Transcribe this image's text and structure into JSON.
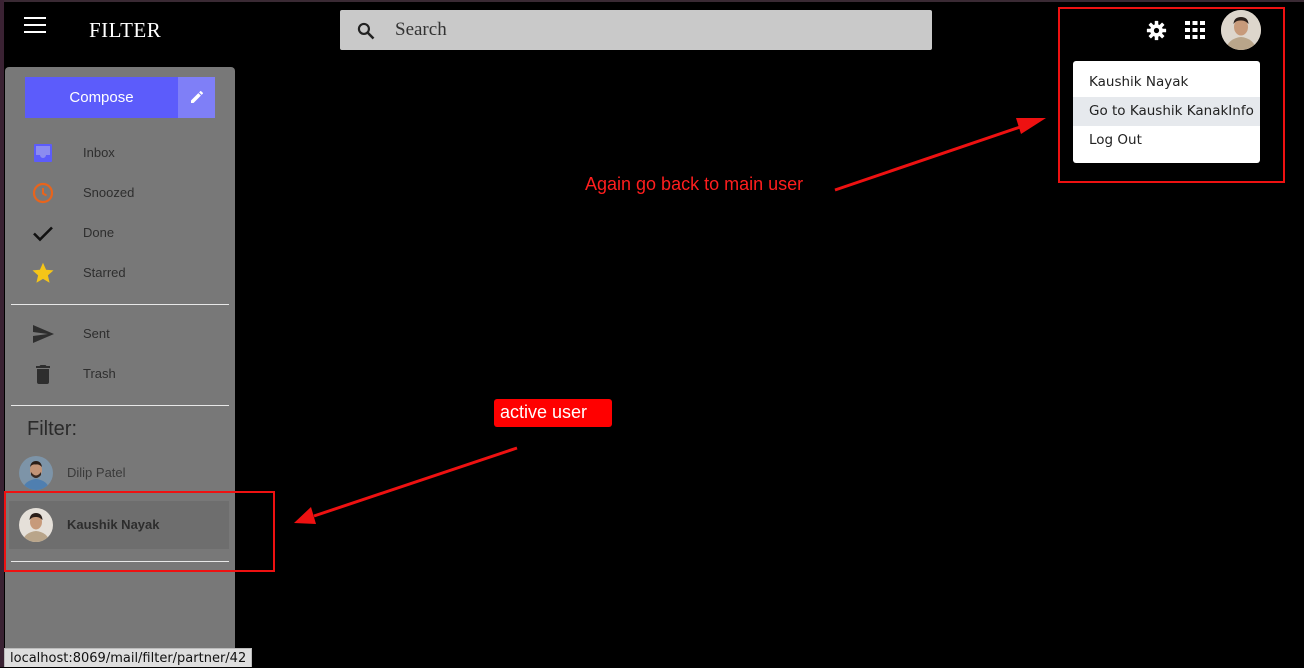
{
  "header": {
    "title": "FILTER",
    "search_placeholder": "Search"
  },
  "user_menu": {
    "items": [
      "Kaushik Nayak",
      "Go to Kaushik KanakInfo",
      "Log Out"
    ]
  },
  "sidebar": {
    "compose_label": "Compose",
    "nav_primary": [
      {
        "label": "Inbox",
        "icon": "inbox-icon",
        "color": "#5c5cfb"
      },
      {
        "label": "Snoozed",
        "icon": "clock-icon",
        "color": "#e8641c"
      },
      {
        "label": "Done",
        "icon": "check-icon",
        "color": "#111111"
      },
      {
        "label": "Starred",
        "icon": "star-icon",
        "color": "#f5c518"
      }
    ],
    "nav_secondary": [
      {
        "label": "Sent",
        "icon": "send-icon",
        "color": "#2e2e2e"
      },
      {
        "label": "Trash",
        "icon": "trash-icon",
        "color": "#2e2e2e"
      }
    ],
    "filter_label": "Filter:",
    "filter_users": [
      {
        "name": "Dilip Patel",
        "active": false
      },
      {
        "name": "Kaushik Nayak",
        "active": true
      }
    ]
  },
  "annotations": {
    "main_user_note": "Again go back to main user",
    "active_user_note": "active user",
    "color": "#ff1e1e"
  },
  "status_bar": {
    "url": "localhost:8069/mail/filter/partner/42"
  }
}
